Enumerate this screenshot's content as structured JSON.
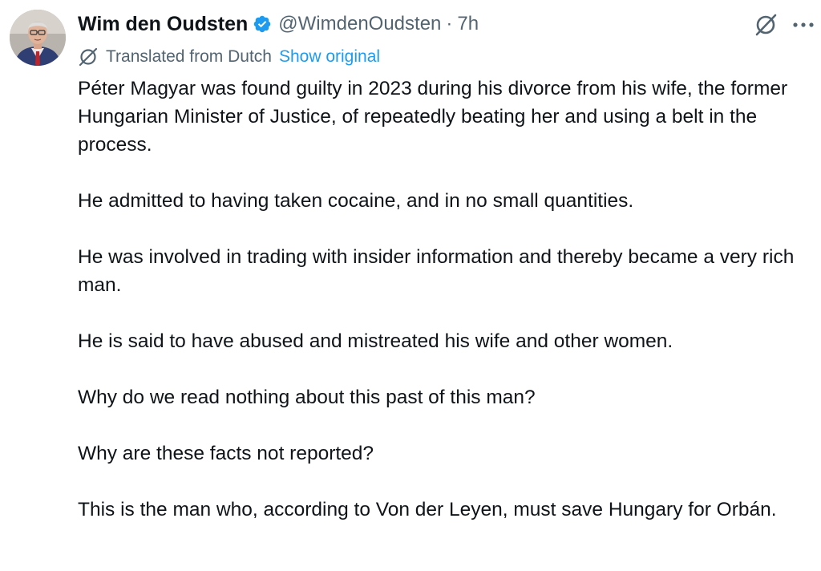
{
  "author": {
    "name": "Wim den Oudsten",
    "handle": "@WimdenOudsten",
    "separator": "·",
    "time": "7h",
    "verified_icon": "verified-badge-icon",
    "avatar_description": "profile photo"
  },
  "actions": {
    "grok_icon": "grok-icon",
    "more_icon": "more-options-icon"
  },
  "translation": {
    "label": "Translated from Dutch",
    "show_original": "Show original",
    "icon": "translate-icon"
  },
  "paragraphs": [
    "Péter Magyar was found guilty in 2023 during his divorce from his wife, the former Hungarian Minister of Justice, of repeatedly beating her and using a belt in the process.",
    "He admitted to having taken cocaine, and in no small quantities.",
    "He was involved in trading with insider information and thereby became a very rich man.",
    "He is said to have abused and mistreated his wife and other women.",
    "Why do we read nothing about this past of this man?",
    "Why are these facts not reported?",
    "This is the man who, according to Von der Leyen, must save Hungary for Orbán."
  ],
  "colors": {
    "text": "#0f1419",
    "secondary": "#536471",
    "link": "#1d9bf0",
    "verified": "#1d9bf0",
    "background": "#ffffff"
  }
}
